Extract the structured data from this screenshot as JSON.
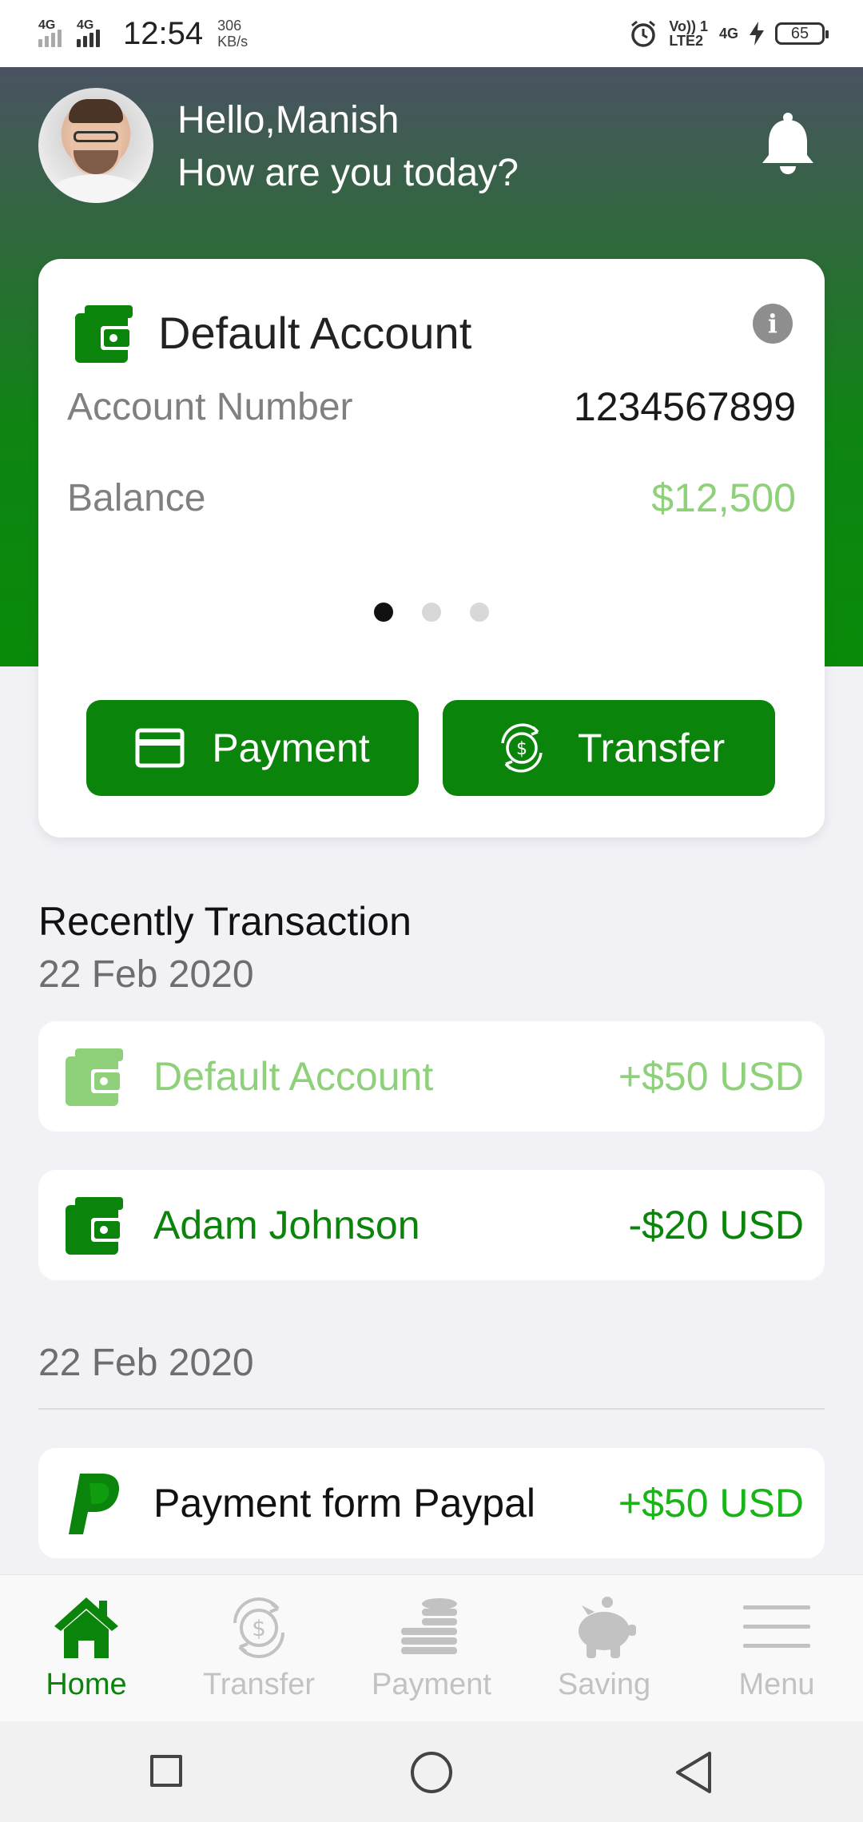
{
  "status_bar": {
    "net1": "4G",
    "net2": "4G",
    "time": "12:54",
    "speed_value": "306",
    "speed_unit": "KB/s",
    "volte_top": "Vo)) 1",
    "volte_bottom": "LTE2",
    "net3": "4G",
    "battery": "65"
  },
  "header": {
    "greeting_line1": "Hello,Manish",
    "greeting_line2": "How are you today?"
  },
  "account_card": {
    "title": "Default Account",
    "info_glyph": "i",
    "account_number_label": "Account Number",
    "account_number": "1234567899",
    "balance_label": "Balance",
    "balance": "$12,500",
    "pager_total": 3,
    "pager_active": 1,
    "payment_label": "Payment",
    "transfer_label": "Transfer"
  },
  "transactions": {
    "section_title": "Recently Transaction",
    "groups": [
      {
        "date": "22 Feb 2020",
        "items": [
          {
            "name": "Default Account",
            "amount": "+$50 USD",
            "icon": "wallet-icon",
            "color": "#8fd07a"
          },
          {
            "name": "Adam Johnson",
            "amount": "-$20 USD",
            "icon": "wallet-icon",
            "color": "#0a840a"
          }
        ]
      },
      {
        "date": "22 Feb 2020",
        "items": [
          {
            "name": "Payment form Paypal",
            "amount": "+$50 USD",
            "icon": "paypal-icon",
            "color": "#18b418"
          }
        ]
      }
    ]
  },
  "tabs": [
    {
      "label": "Home",
      "icon": "home-icon",
      "active": true
    },
    {
      "label": "Transfer",
      "icon": "transfer-icon",
      "active": false
    },
    {
      "label": "Payment",
      "icon": "coins-icon",
      "active": false
    },
    {
      "label": "Saving",
      "icon": "piggy-bank-icon",
      "active": false
    },
    {
      "label": "Menu",
      "icon": "menu-icon",
      "active": false
    }
  ],
  "colors": {
    "brand_green": "#0a840a",
    "balance_green": "#8fd07a",
    "paypal_green": "#18b418",
    "tab_inactive": "#c2c2c2"
  }
}
